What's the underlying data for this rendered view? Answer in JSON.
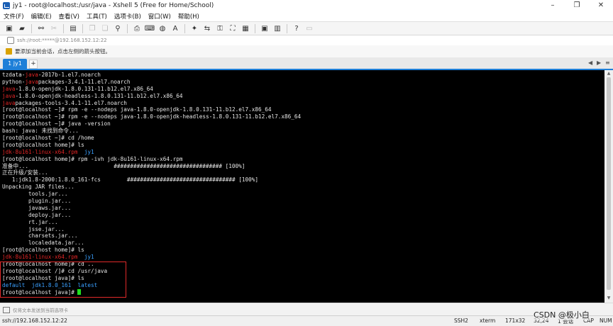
{
  "window": {
    "title": "jy1 - root@localhost:/usr/java - Xshell 5 (Free for Home/School)",
    "minimize": "–",
    "maximize": "❐",
    "close": "✕"
  },
  "menu": [
    "文件(F)",
    "编辑(E)",
    "查看(V)",
    "工具(T)",
    "选项卡(B)",
    "窗口(W)",
    "帮助(H)"
  ],
  "address": "ssh://root:*****@192.168.152.12:22",
  "hint": "要添加当前会话，点击左侧的箭头按钮。",
  "tabs": {
    "active": "1 jy1",
    "add": "+"
  },
  "terminal": {
    "lines": [
      [
        {
          "t": "tzdata-"
        },
        {
          "t": "java",
          "c": "red"
        },
        {
          "t": "-2017b-1.el7.noarch"
        }
      ],
      [
        {
          "t": "python-"
        },
        {
          "t": "java",
          "c": "red"
        },
        {
          "t": "packages-3.4.1-11.el7.noarch"
        }
      ],
      [
        {
          "t": "java",
          "c": "red"
        },
        {
          "t": "-1.8.0-openjdk-1.8.0.131-11.b12.el7.x86_64"
        }
      ],
      [
        {
          "t": "java",
          "c": "red"
        },
        {
          "t": "-1.8.0-openjdk-headless-1.8.0.131-11.b12.el7.x86_64"
        }
      ],
      [
        {
          "t": "java",
          "c": "red"
        },
        {
          "t": "packages-tools-3.4.1-11.el7.noarch"
        }
      ],
      [
        {
          "t": "[root@localhost ~]# rpm -e --nodeps java-1.8.0-openjdk-1.8.0.131-11.b12.el7.x86_64"
        }
      ],
      [
        {
          "t": "[root@localhost ~]# rpm -e --nodeps java-1.8.0-openjdk-headless-1.8.0.131-11.b12.el7.x86_64"
        }
      ],
      [
        {
          "t": "[root@localhost ~]# java -version"
        }
      ],
      [
        {
          "t": "bash: java: 未找到命令..."
        }
      ],
      [
        {
          "t": "[root@localhost ~]# cd /home"
        }
      ],
      [
        {
          "t": "[root@localhost home]# ls"
        }
      ],
      [
        {
          "t": "jdk-8u161-linux-x64.rpm",
          "c": "red"
        },
        {
          "t": "  "
        },
        {
          "t": "jy1",
          "c": "blue"
        }
      ],
      [
        {
          "t": "[root@localhost home]# rpm -ivh jdk-8u161-linux-x64.rpm"
        }
      ],
      [
        {
          "t": "准备中...                          ################################# [100%]"
        }
      ],
      [
        {
          "t": "正在升级/安装..."
        }
      ],
      [
        {
          "t": "   1:jdk1.8-2000:1.8.0_161-fcs        ################################# [100%]"
        }
      ],
      [
        {
          "t": "Unpacking JAR files..."
        }
      ],
      [
        {
          "t": "        tools.jar..."
        }
      ],
      [
        {
          "t": "        plugin.jar..."
        }
      ],
      [
        {
          "t": "        javaws.jar..."
        }
      ],
      [
        {
          "t": "        deploy.jar..."
        }
      ],
      [
        {
          "t": "        rt.jar..."
        }
      ],
      [
        {
          "t": "        jsse.jar..."
        }
      ],
      [
        {
          "t": "        charsets.jar..."
        }
      ],
      [
        {
          "t": "        localedata.jar..."
        }
      ],
      [
        {
          "t": "[root@localhost home]# ls"
        }
      ],
      [
        {
          "t": "jdk-8u161-linux-x64.rpm",
          "c": "red"
        },
        {
          "t": "  "
        },
        {
          "t": "jy1",
          "c": "blue"
        }
      ],
      [
        {
          "t": "[root@localhost home]# cd .."
        }
      ],
      [
        {
          "t": "[root@localhost /]# cd /usr/java"
        }
      ],
      [
        {
          "t": "[root@localhost java]# ls"
        }
      ],
      [
        {
          "t": "default",
          "c": "blue"
        },
        {
          "t": "  "
        },
        {
          "t": "jdk1.8.0_161",
          "c": "blue"
        },
        {
          "t": "  "
        },
        {
          "t": "latest",
          "c": "blue"
        }
      ],
      [
        {
          "t": "[root@localhost java]# "
        },
        {
          "cursor": true
        }
      ]
    ]
  },
  "compose_placeholder": "仅将文本发送到当前选项卡",
  "status": {
    "host": "ssh://192.168.152.12:22",
    "protocol": "SSH2",
    "term": "xterm",
    "size": "171x32",
    "pos": "32,24",
    "sessions": "1 会话",
    "caps": "CAP",
    "num": "NUM"
  },
  "watermark": "CSDN @极小白"
}
